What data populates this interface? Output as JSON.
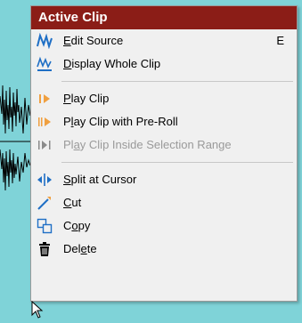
{
  "menu": {
    "title": "Active Clip",
    "items": [
      {
        "pre": "",
        "mnemonic": "E",
        "post": "dit Source",
        "shortcut": "E",
        "icon": "edit-source-icon",
        "enabled": true
      },
      {
        "pre": "",
        "mnemonic": "D",
        "post": "isplay Whole Clip",
        "shortcut": "",
        "icon": "display-whole-clip-icon",
        "enabled": true
      },
      {
        "pre": "",
        "mnemonic": "P",
        "post": "lay Clip",
        "shortcut": "",
        "icon": "play-clip-icon",
        "enabled": true
      },
      {
        "pre": "P",
        "mnemonic": "l",
        "post": "ay Clip with Pre-Roll",
        "shortcut": "",
        "icon": "play-preroll-icon",
        "enabled": true
      },
      {
        "pre": "Pl",
        "mnemonic": "a",
        "post": "y Clip Inside Selection Range",
        "shortcut": "",
        "icon": "play-selection-icon",
        "enabled": false
      },
      {
        "pre": "",
        "mnemonic": "S",
        "post": "plit at Cursor",
        "shortcut": "",
        "icon": "split-icon",
        "enabled": true
      },
      {
        "pre": "",
        "mnemonic": "C",
        "post": "ut",
        "shortcut": "",
        "icon": "cut-icon",
        "enabled": true
      },
      {
        "pre": "C",
        "mnemonic": "o",
        "post": "py",
        "shortcut": "",
        "icon": "copy-icon",
        "enabled": true
      },
      {
        "pre": "Del",
        "mnemonic": "e",
        "post": "te",
        "shortcut": "",
        "icon": "delete-icon",
        "enabled": true
      }
    ]
  },
  "colors": {
    "title_bg": "#8b1d17",
    "background": "#7fd3d8",
    "accent_blue": "#1f6fc5",
    "accent_orange": "#f0a040"
  }
}
